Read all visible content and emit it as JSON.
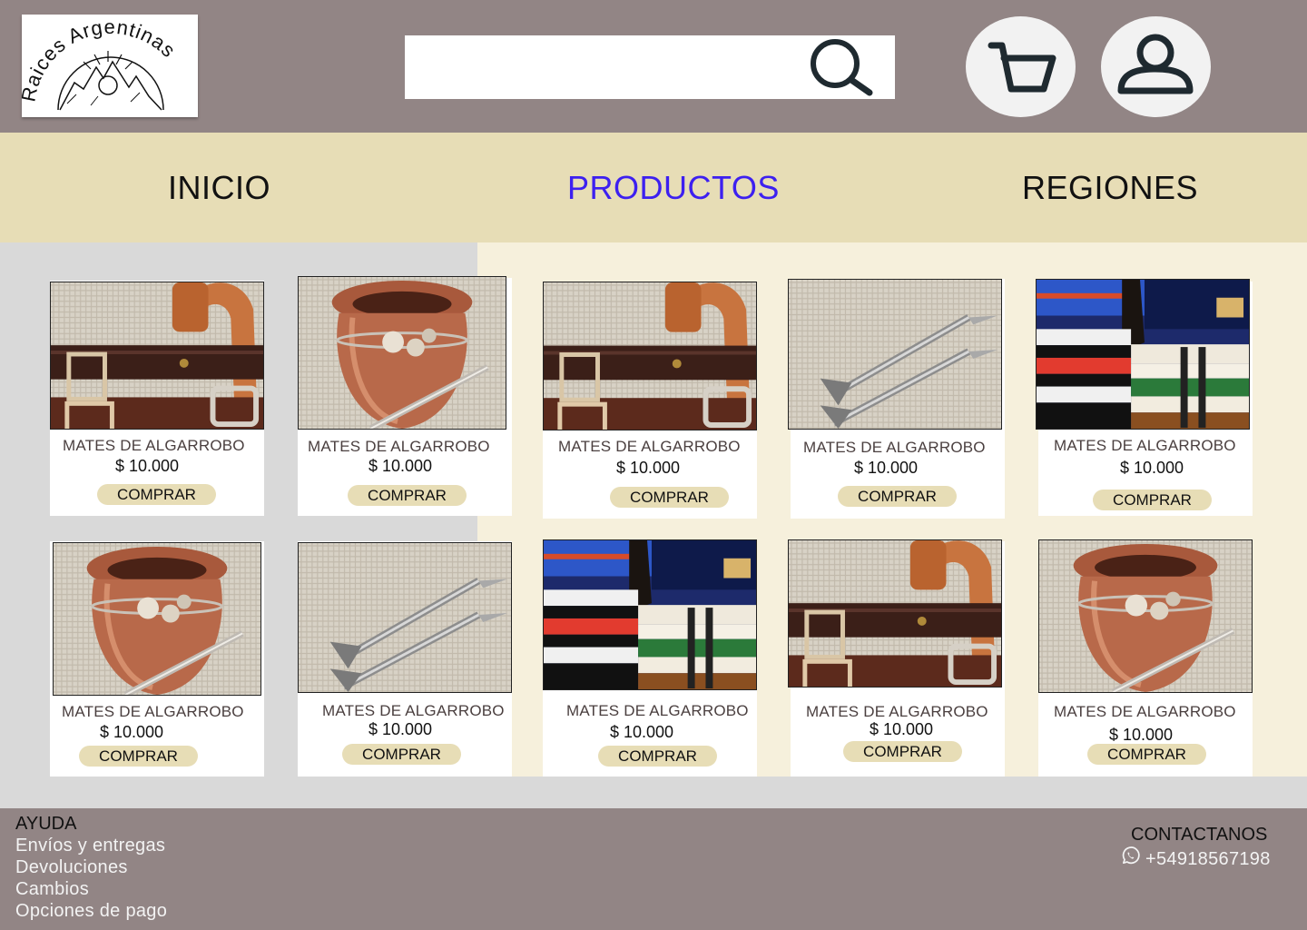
{
  "brand": {
    "logo_text": "Raices Argentinas"
  },
  "search": {
    "placeholder": "",
    "value": ""
  },
  "nav": {
    "items": [
      "INICIO",
      "PRODUCTOS",
      "REGIONES"
    ],
    "active": "PRODUCTOS",
    "active_color": "#3d20f0"
  },
  "products": [
    {
      "name": "MATES DE ALGARROBO",
      "price": "$ 10.000",
      "button": "COMPRAR",
      "image": "belts"
    },
    {
      "name": "MATES DE ALGARROBO",
      "price": "$ 10.000",
      "button": "COMPRAR",
      "image": "mate"
    },
    {
      "name": "MATES DE ALGARROBO",
      "price": "$ 10.000",
      "button": "COMPRAR",
      "image": "belts"
    },
    {
      "name": "MATES DE ALGARROBO",
      "price": "$ 10.000",
      "button": "COMPRAR",
      "image": "bombillas"
    },
    {
      "name": "MATES DE ALGARROBO",
      "price": "$ 10.000",
      "button": "COMPRAR",
      "image": "ponchos"
    },
    {
      "name": "MATES DE ALGARROBO",
      "price": "$ 10.000",
      "button": "COMPRAR",
      "image": "mate"
    },
    {
      "name": "MATES DE ALGARROBO",
      "price": "$ 10.000",
      "button": "COMPRAR",
      "image": "bombillas"
    },
    {
      "name": "MATES DE ALGARROBO",
      "price": "$ 10.000",
      "button": "COMPRAR",
      "image": "ponchos"
    },
    {
      "name": "MATES DE ALGARROBO",
      "price": "$ 10.000",
      "button": "COMPRAR",
      "image": "belts"
    },
    {
      "name": "MATES DE ALGARROBO",
      "price": "$ 10.000",
      "button": "COMPRAR",
      "image": "mate"
    }
  ],
  "footer": {
    "help_title": "AYUDA",
    "help_links": [
      "Envíos y entregas",
      "Devoluciones",
      "Cambios",
      "Opciones de pago"
    ],
    "contact_title": "CONTACTANOS",
    "phone": "+54918567198"
  },
  "colors": {
    "header": "#928585",
    "nav": "#e7ddb6",
    "button": "#e7ddb6",
    "main_right": "#f6f0dc",
    "main_left": "#d9d9d9"
  }
}
